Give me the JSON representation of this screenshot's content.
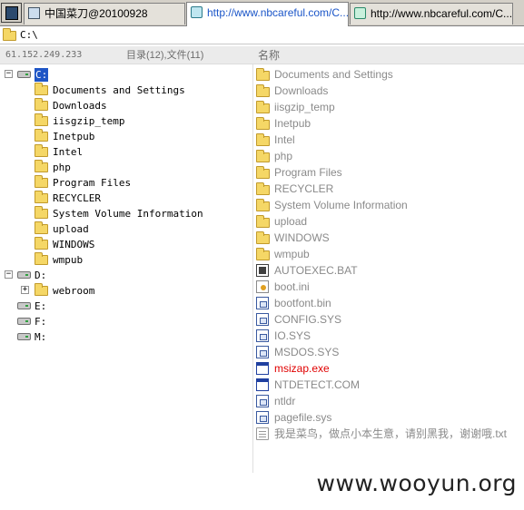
{
  "tabs": [
    {
      "label": "中国菜刀@20100928",
      "icon": "page-icon",
      "active": false
    },
    {
      "label": "http://www.nbcareful.com/C...",
      "icon": "ie-icon",
      "active": true
    },
    {
      "label": "http://www.nbcareful.com/C...",
      "icon": "ie-icon",
      "active": false
    }
  ],
  "address": {
    "path": "C:\\"
  },
  "header": {
    "ip": "61.152.249.233",
    "counts": "目录(12),文件(11)",
    "column_name": "名称"
  },
  "tree": {
    "drives": [
      {
        "label": "C:",
        "selected": true,
        "expanded": true,
        "folders": [
          "Documents and Settings",
          "Downloads",
          "iisgzip_temp",
          "Inetpub",
          "Intel",
          "php",
          "Program Files",
          "RECYCLER",
          "System Volume Information",
          "upload",
          "WINDOWS",
          "wmpub"
        ]
      },
      {
        "label": "D:",
        "selected": false,
        "expanded": true,
        "folders": [
          "webroom"
        ]
      },
      {
        "label": "E:",
        "selected": false,
        "expanded": false,
        "folders": []
      },
      {
        "label": "F:",
        "selected": false,
        "expanded": false,
        "folders": []
      },
      {
        "label": "M:",
        "selected": false,
        "expanded": false,
        "folders": []
      }
    ]
  },
  "files": [
    {
      "name": "Documents and Settings",
      "kind": "folder"
    },
    {
      "name": "Downloads",
      "kind": "folder"
    },
    {
      "name": "iisgzip_temp",
      "kind": "folder"
    },
    {
      "name": "Inetpub",
      "kind": "folder"
    },
    {
      "name": "Intel",
      "kind": "folder"
    },
    {
      "name": "php",
      "kind": "folder"
    },
    {
      "name": "Program Files",
      "kind": "folder"
    },
    {
      "name": "RECYCLER",
      "kind": "folder"
    },
    {
      "name": "System Volume Information",
      "kind": "folder"
    },
    {
      "name": "upload",
      "kind": "folder"
    },
    {
      "name": "WINDOWS",
      "kind": "folder"
    },
    {
      "name": "wmpub",
      "kind": "folder"
    },
    {
      "name": "AUTOEXEC.BAT",
      "kind": "bat"
    },
    {
      "name": "boot.ini",
      "kind": "ini"
    },
    {
      "name": "bootfont.bin",
      "kind": "sys"
    },
    {
      "name": "CONFIG.SYS",
      "kind": "sys"
    },
    {
      "name": "IO.SYS",
      "kind": "sys"
    },
    {
      "name": "MSDOS.SYS",
      "kind": "sys"
    },
    {
      "name": "msizap.exe",
      "kind": "exe",
      "highlight": "#e00000"
    },
    {
      "name": "NTDETECT.COM",
      "kind": "exe"
    },
    {
      "name": "ntldr",
      "kind": "sys"
    },
    {
      "name": "pagefile.sys",
      "kind": "sys"
    },
    {
      "name": "我是菜鸟，做点小本生意，请别黑我，谢谢哦.txt",
      "kind": "txt"
    }
  ],
  "watermark": "www.wooyun.org"
}
